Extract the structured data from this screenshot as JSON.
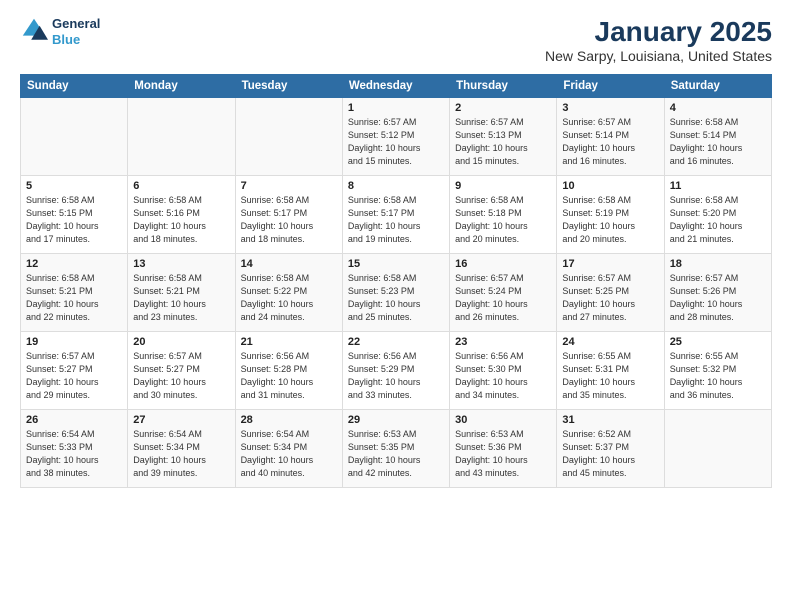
{
  "header": {
    "logo_line1": "General",
    "logo_line2": "Blue",
    "month": "January 2025",
    "location": "New Sarpy, Louisiana, United States"
  },
  "weekdays": [
    "Sunday",
    "Monday",
    "Tuesday",
    "Wednesday",
    "Thursday",
    "Friday",
    "Saturday"
  ],
  "weeks": [
    [
      {
        "day": "",
        "info": ""
      },
      {
        "day": "",
        "info": ""
      },
      {
        "day": "",
        "info": ""
      },
      {
        "day": "1",
        "info": "Sunrise: 6:57 AM\nSunset: 5:12 PM\nDaylight: 10 hours\nand 15 minutes."
      },
      {
        "day": "2",
        "info": "Sunrise: 6:57 AM\nSunset: 5:13 PM\nDaylight: 10 hours\nand 15 minutes."
      },
      {
        "day": "3",
        "info": "Sunrise: 6:57 AM\nSunset: 5:14 PM\nDaylight: 10 hours\nand 16 minutes."
      },
      {
        "day": "4",
        "info": "Sunrise: 6:58 AM\nSunset: 5:14 PM\nDaylight: 10 hours\nand 16 minutes."
      }
    ],
    [
      {
        "day": "5",
        "info": "Sunrise: 6:58 AM\nSunset: 5:15 PM\nDaylight: 10 hours\nand 17 minutes."
      },
      {
        "day": "6",
        "info": "Sunrise: 6:58 AM\nSunset: 5:16 PM\nDaylight: 10 hours\nand 18 minutes."
      },
      {
        "day": "7",
        "info": "Sunrise: 6:58 AM\nSunset: 5:17 PM\nDaylight: 10 hours\nand 18 minutes."
      },
      {
        "day": "8",
        "info": "Sunrise: 6:58 AM\nSunset: 5:17 PM\nDaylight: 10 hours\nand 19 minutes."
      },
      {
        "day": "9",
        "info": "Sunrise: 6:58 AM\nSunset: 5:18 PM\nDaylight: 10 hours\nand 20 minutes."
      },
      {
        "day": "10",
        "info": "Sunrise: 6:58 AM\nSunset: 5:19 PM\nDaylight: 10 hours\nand 20 minutes."
      },
      {
        "day": "11",
        "info": "Sunrise: 6:58 AM\nSunset: 5:20 PM\nDaylight: 10 hours\nand 21 minutes."
      }
    ],
    [
      {
        "day": "12",
        "info": "Sunrise: 6:58 AM\nSunset: 5:21 PM\nDaylight: 10 hours\nand 22 minutes."
      },
      {
        "day": "13",
        "info": "Sunrise: 6:58 AM\nSunset: 5:21 PM\nDaylight: 10 hours\nand 23 minutes."
      },
      {
        "day": "14",
        "info": "Sunrise: 6:58 AM\nSunset: 5:22 PM\nDaylight: 10 hours\nand 24 minutes."
      },
      {
        "day": "15",
        "info": "Sunrise: 6:58 AM\nSunset: 5:23 PM\nDaylight: 10 hours\nand 25 minutes."
      },
      {
        "day": "16",
        "info": "Sunrise: 6:57 AM\nSunset: 5:24 PM\nDaylight: 10 hours\nand 26 minutes."
      },
      {
        "day": "17",
        "info": "Sunrise: 6:57 AM\nSunset: 5:25 PM\nDaylight: 10 hours\nand 27 minutes."
      },
      {
        "day": "18",
        "info": "Sunrise: 6:57 AM\nSunset: 5:26 PM\nDaylight: 10 hours\nand 28 minutes."
      }
    ],
    [
      {
        "day": "19",
        "info": "Sunrise: 6:57 AM\nSunset: 5:27 PM\nDaylight: 10 hours\nand 29 minutes."
      },
      {
        "day": "20",
        "info": "Sunrise: 6:57 AM\nSunset: 5:27 PM\nDaylight: 10 hours\nand 30 minutes."
      },
      {
        "day": "21",
        "info": "Sunrise: 6:56 AM\nSunset: 5:28 PM\nDaylight: 10 hours\nand 31 minutes."
      },
      {
        "day": "22",
        "info": "Sunrise: 6:56 AM\nSunset: 5:29 PM\nDaylight: 10 hours\nand 33 minutes."
      },
      {
        "day": "23",
        "info": "Sunrise: 6:56 AM\nSunset: 5:30 PM\nDaylight: 10 hours\nand 34 minutes."
      },
      {
        "day": "24",
        "info": "Sunrise: 6:55 AM\nSunset: 5:31 PM\nDaylight: 10 hours\nand 35 minutes."
      },
      {
        "day": "25",
        "info": "Sunrise: 6:55 AM\nSunset: 5:32 PM\nDaylight: 10 hours\nand 36 minutes."
      }
    ],
    [
      {
        "day": "26",
        "info": "Sunrise: 6:54 AM\nSunset: 5:33 PM\nDaylight: 10 hours\nand 38 minutes."
      },
      {
        "day": "27",
        "info": "Sunrise: 6:54 AM\nSunset: 5:34 PM\nDaylight: 10 hours\nand 39 minutes."
      },
      {
        "day": "28",
        "info": "Sunrise: 6:54 AM\nSunset: 5:34 PM\nDaylight: 10 hours\nand 40 minutes."
      },
      {
        "day": "29",
        "info": "Sunrise: 6:53 AM\nSunset: 5:35 PM\nDaylight: 10 hours\nand 42 minutes."
      },
      {
        "day": "30",
        "info": "Sunrise: 6:53 AM\nSunset: 5:36 PM\nDaylight: 10 hours\nand 43 minutes."
      },
      {
        "day": "31",
        "info": "Sunrise: 6:52 AM\nSunset: 5:37 PM\nDaylight: 10 hours\nand 45 minutes."
      },
      {
        "day": "",
        "info": ""
      }
    ]
  ]
}
